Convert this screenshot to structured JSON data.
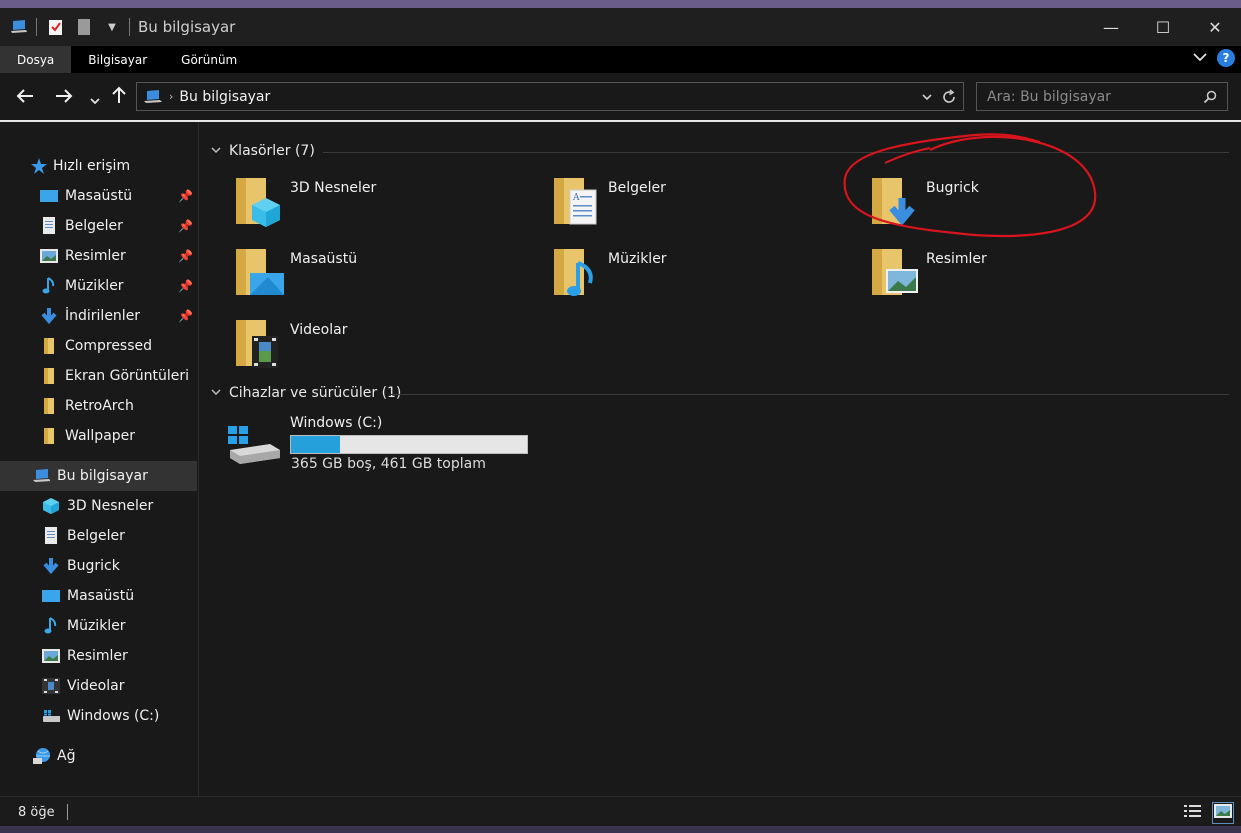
{
  "window": {
    "title": "Bu bilgisayar",
    "controls": {
      "minimize": "—",
      "maximize": "☐",
      "close": "✕"
    }
  },
  "ribbon": {
    "tabs": [
      {
        "label": "Dosya",
        "active": true
      },
      {
        "label": "Bilgisayar",
        "active": false
      },
      {
        "label": "Görünüm",
        "active": false
      }
    ],
    "help": "?"
  },
  "address": {
    "path": "Bu bilgisayar",
    "search_placeholder": "Ara: Bu bilgisayar"
  },
  "sidebar": {
    "quick_access": {
      "label": "Hızlı erişim",
      "items": [
        {
          "label": "Masaüstü",
          "icon": "desktop-icon",
          "pinned": true
        },
        {
          "label": "Belgeler",
          "icon": "documents-icon",
          "pinned": true
        },
        {
          "label": "Resimler",
          "icon": "pictures-icon",
          "pinned": true
        },
        {
          "label": "Müzikler",
          "icon": "music-icon",
          "pinned": true
        },
        {
          "label": "İndirilenler",
          "icon": "downloads-icon",
          "pinned": true
        },
        {
          "label": "Compressed",
          "icon": "folder-icon",
          "pinned": false
        },
        {
          "label": "Ekran Görüntüleri",
          "icon": "folder-icon",
          "pinned": false
        },
        {
          "label": "RetroArch",
          "icon": "folder-icon",
          "pinned": false
        },
        {
          "label": "Wallpaper",
          "icon": "folder-icon",
          "pinned": false
        }
      ]
    },
    "this_pc": {
      "label": "Bu bilgisayar",
      "items": [
        {
          "label": "3D Nesneler",
          "icon": "3d-objects-icon"
        },
        {
          "label": "Belgeler",
          "icon": "documents-icon"
        },
        {
          "label": "Bugrick",
          "icon": "downloads-icon"
        },
        {
          "label": "Masaüstü",
          "icon": "desktop-icon"
        },
        {
          "label": "Müzikler",
          "icon": "music-icon"
        },
        {
          "label": "Resimler",
          "icon": "pictures-icon"
        },
        {
          "label": "Videolar",
          "icon": "videos-icon"
        },
        {
          "label": "Windows (C:)",
          "icon": "drive-icon"
        }
      ]
    },
    "network": {
      "label": "Ağ"
    }
  },
  "content": {
    "folders_header": "Klasörler (7)",
    "folders": [
      {
        "label": "3D Nesneler",
        "icon": "3d-objects-folder-icon"
      },
      {
        "label": "Belgeler",
        "icon": "documents-folder-icon"
      },
      {
        "label": "Bugrick",
        "icon": "downloads-folder-icon"
      },
      {
        "label": "Masaüstü",
        "icon": "desktop-folder-icon"
      },
      {
        "label": "Müzikler",
        "icon": "music-folder-icon"
      },
      {
        "label": "Resimler",
        "icon": "pictures-folder-icon"
      },
      {
        "label": "Videolar",
        "icon": "videos-folder-icon"
      }
    ],
    "devices_header": "Cihazlar ve sürücüler (1)",
    "drive": {
      "label": "Windows (C:)",
      "free_text": "365 GB boş, 461 GB toplam",
      "used_fraction": 0.208
    }
  },
  "status": {
    "item_count": "8 öğe"
  },
  "colors": {
    "accent": "#26a0da",
    "annotation": "#e0141e",
    "folder": "#e8c56a"
  }
}
